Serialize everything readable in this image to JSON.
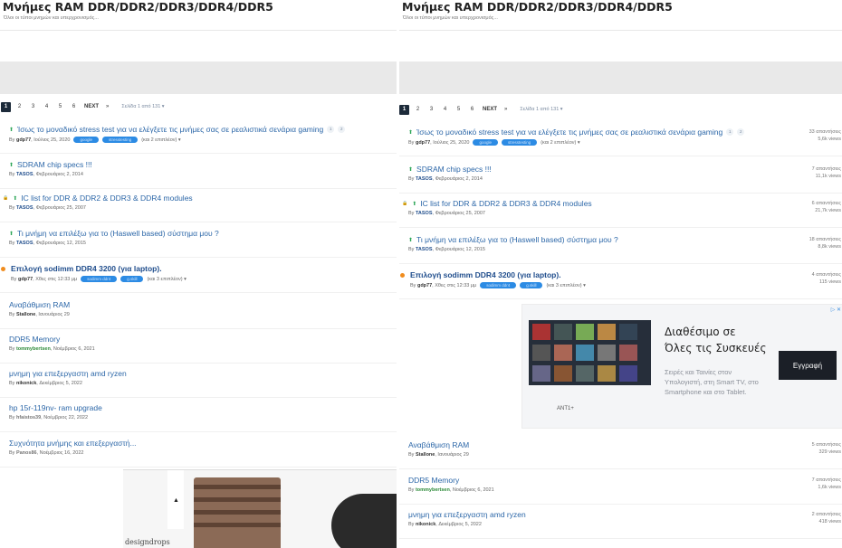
{
  "forum": {
    "title": "Μνήμες RAM DDR/DDR2/DDR3/DDR4/DDR5",
    "subtitle": "Όλοι οι τύποι μνημών και υπερχρονισμός..."
  },
  "pagination": {
    "pages": [
      "1",
      "2",
      "3",
      "4",
      "5",
      "6"
    ],
    "current": "1",
    "next_label": "NEXT",
    "last_label": "»",
    "page_of": "Σελίδα 1 από 131 ▾"
  },
  "topics": [
    {
      "title": "Ίσως το μοναδικό stress test για να ελέγξετε τις μνήμες σας σε ρεαλιστικά σενάρια gaming",
      "pinned": true,
      "locked": false,
      "unread": false,
      "bold": false,
      "mini_pages": [
        "1",
        "2"
      ],
      "author": "gdp77",
      "author_color": "#333333",
      "date": "Ιούλιος 25, 2020",
      "tags": [
        "google",
        "stresstesting"
      ],
      "more": "(και 2 επιπλέον) ▾",
      "replies": "33 απαντήσεις",
      "views": "5,6k views"
    },
    {
      "title": "SDRAM chip specs !!!",
      "pinned": true,
      "locked": false,
      "unread": false,
      "bold": false,
      "mini_pages": [],
      "author": "TASOS",
      "author_color": "#1f4d8c",
      "date": "Φεβρουάριος 2, 2014",
      "tags": [],
      "more": "",
      "replies": "7 απαντήσεις",
      "views": "11,1k views"
    },
    {
      "title": "IC list for DDR & DDR2 & DDR3 & DDR4 modules",
      "pinned": true,
      "locked": true,
      "unread": false,
      "bold": false,
      "mini_pages": [],
      "author": "TASOS",
      "author_color": "#1f4d8c",
      "date": "Φεβρουάριος 25, 2007",
      "tags": [],
      "more": "",
      "replies": "6 απαντήσεις",
      "views": "21,7k views"
    },
    {
      "title": "Τι μνήμη να επιλέξω για το (Haswell based) σύστημα μου ?",
      "pinned": true,
      "locked": false,
      "unread": false,
      "bold": false,
      "mini_pages": [],
      "author": "TASOS",
      "author_color": "#1f4d8c",
      "date": "Φεβρουάριος 12, 2015",
      "tags": [],
      "more": "",
      "replies": "18 απαντήσεις",
      "views": "8,8k views"
    },
    {
      "title": "Επιλογή sodimm DDR4 3200 (για laptop).",
      "pinned": false,
      "locked": false,
      "unread": true,
      "bold": true,
      "mini_pages": [],
      "author": "gdp77",
      "author_color": "#333333",
      "date": "Χθες στις 12:33 μμ",
      "tags": [
        "sodimm ddr4",
        "g.skill"
      ],
      "more": "(και 3 επιπλέον) ▾",
      "replies": "4 απαντήσεις",
      "views": "115 views"
    },
    {
      "title": "Αναβάθμιση RAM",
      "pinned": false,
      "locked": false,
      "unread": false,
      "bold": false,
      "mini_pages": [],
      "author": "Stallone",
      "author_color": "#333333",
      "date": "Ιανουάριος 29",
      "tags": [],
      "more": "",
      "replies": "5 απαντήσεις",
      "views": "329 views"
    },
    {
      "title": "DDR5 Memory",
      "pinned": false,
      "locked": false,
      "unread": false,
      "bold": false,
      "mini_pages": [],
      "author": "tommybertsen",
      "author_color": "#2e8b3a",
      "date": "Νοέμβριος 6, 2021",
      "tags": [],
      "more": "",
      "replies": "7 απαντήσεις",
      "views": "1,6k views"
    },
    {
      "title": "μνημη για επεξεργαστη amd ryzen",
      "pinned": false,
      "locked": false,
      "unread": false,
      "bold": false,
      "mini_pages": [],
      "author": "nikonick",
      "author_color": "#333333",
      "date": "Δεκέμβριος 5, 2022",
      "tags": [],
      "more": "",
      "replies": "2 απαντήσεις",
      "views": "418 views"
    },
    {
      "title": "hp 15r-119nv- ram upgrade",
      "pinned": false,
      "locked": false,
      "unread": false,
      "bold": false,
      "mini_pages": [],
      "author": "hfaistos39",
      "author_color": "#777777",
      "date": "Νοέμβριος 22, 2022",
      "tags": [],
      "more": "",
      "replies": "",
      "views": ""
    },
    {
      "title": "Συχνότητα μνήμης και επεξεργαστή...",
      "pinned": false,
      "locked": false,
      "unread": false,
      "bold": false,
      "mini_pages": [],
      "author": "Panos86",
      "author_color": "#777777",
      "date": "Νοέμβριος 16, 2022",
      "tags": [],
      "more": "",
      "replies": "",
      "views": ""
    }
  ],
  "ad_left": {
    "brand": "designdrops",
    "scroll_arrow": "▲"
  },
  "ad_right": {
    "logo": "ANT1+",
    "headline1": "Διαθέσιμο σε",
    "headline2": "Όλες τις Συσκευές",
    "description": "Σειρές και Ταινίες στον Υπολογιστή, στη Smart TV, στο Smartphone και στο Tablet.",
    "cta": "Εγγραφή",
    "adchoices": "▷ ✕"
  },
  "colors": {
    "accent": "#2c67a8",
    "tag": "#2c8be4",
    "pin": "#2ba556",
    "unread": "#f08c1e",
    "cta_bg": "#1b1f27"
  }
}
